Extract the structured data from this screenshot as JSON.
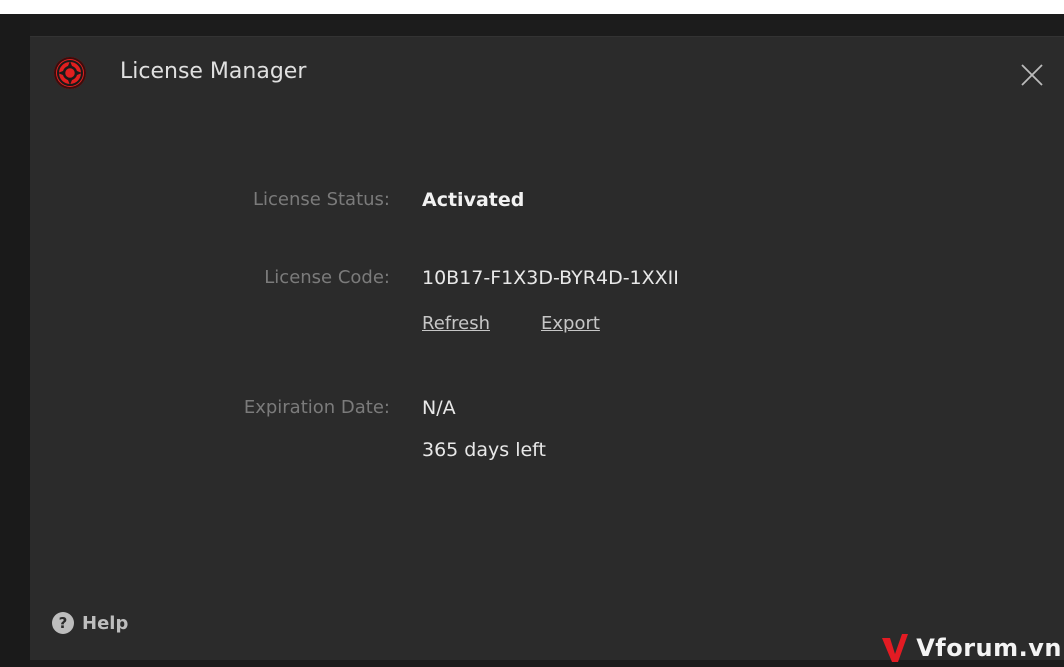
{
  "dialog": {
    "title": "License Manager",
    "close_icon": "close-icon",
    "app_icon": "app-logo-icon"
  },
  "license": {
    "status_label": "License Status:",
    "status_value": "Activated",
    "code_label": "License Code:",
    "code_value": "10B17-F1X3D-BYR4D-1XXII",
    "refresh_label": "Refresh",
    "export_label": "Export",
    "expiration_label": "Expiration Date:",
    "expiration_value": "N/A",
    "days_left": "365 days left"
  },
  "footer": {
    "help_label": "Help",
    "help_icon": "help-circle-icon"
  },
  "watermark": {
    "text": "Vforum.vn"
  },
  "colors": {
    "dialog_bg": "#2b2b2b",
    "accent": "#e01f1f",
    "label": "#7b7b7b",
    "value": "#e8e8e8"
  }
}
